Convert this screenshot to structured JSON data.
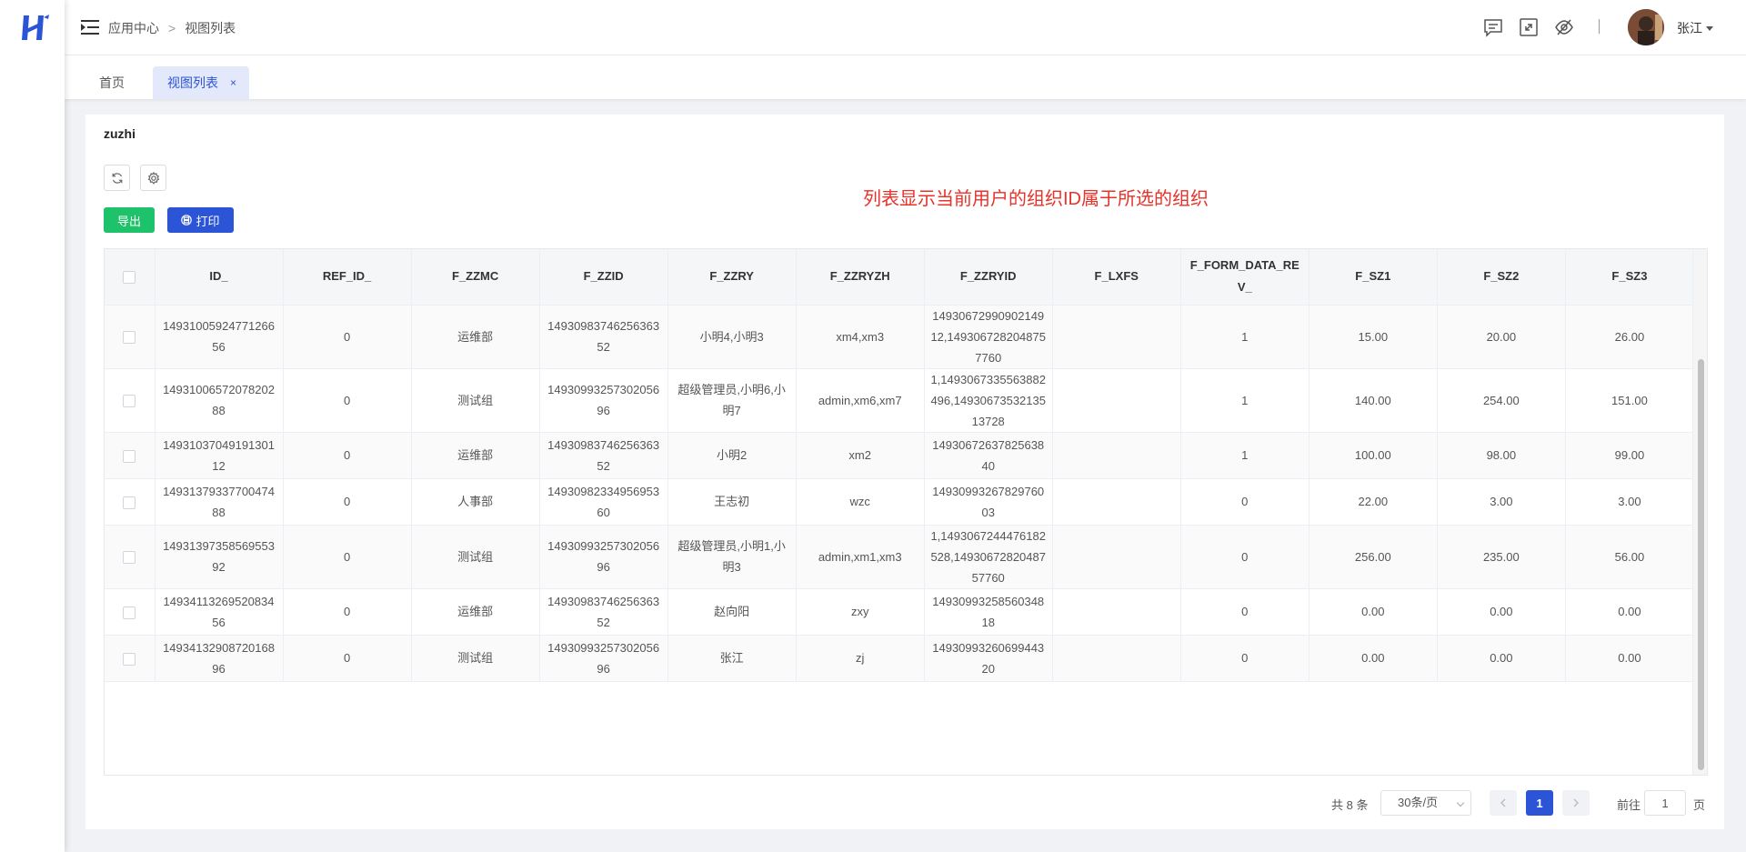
{
  "header": {
    "breadcrumb": [
      "应用中心",
      "视图列表"
    ],
    "breadcrumb_sep": ">",
    "user_name": "张江"
  },
  "tabs": [
    {
      "label": "首页",
      "active": false
    },
    {
      "label": "视图列表",
      "active": true,
      "close": "×"
    }
  ],
  "page": {
    "title": "zuzhi",
    "note": "列表显示当前用户的组织ID属于所选的组织",
    "export_label": "导出",
    "print_label": "打印"
  },
  "table": {
    "columns": [
      "ID_",
      "REF_ID_",
      "F_ZZMC",
      "F_ZZID",
      "F_ZZRY",
      "F_ZZRYZH",
      "F_ZZRYID",
      "F_LXFS",
      "F_FORM_DATA_REV_",
      "F_SZ1",
      "F_SZ2",
      "F_SZ3"
    ],
    "rows": [
      [
        "1493100592477126656",
        "0",
        "运维部",
        "1493098374625636352",
        "小明4,小明3",
        "xm4,xm3",
        "1493067299090214912,1493067282048757760",
        "",
        "1",
        "15.00",
        "20.00",
        "26.00"
      ],
      [
        "1493100657207820288",
        "0",
        "测试组",
        "1493099325730205696",
        "超级管理员,小明6,小明7",
        "admin,xm6,xm7",
        "1,1493067335563882496,1493067353213513728",
        "",
        "1",
        "140.00",
        "254.00",
        "151.00"
      ],
      [
        "1493103704919130112",
        "0",
        "运维部",
        "1493098374625636352",
        "小明2",
        "xm2",
        "1493067263782563840",
        "",
        "1",
        "100.00",
        "98.00",
        "99.00"
      ],
      [
        "1493137933770047488",
        "0",
        "人事部",
        "1493098233495695360",
        "王志初",
        "wzc",
        "1493099326782976003",
        "",
        "0",
        "22.00",
        "3.00",
        "3.00"
      ],
      [
        "1493139735856955392",
        "0",
        "测试组",
        "1493099325730205696",
        "超级管理员,小明1,小明3",
        "admin,xm1,xm3",
        "1,1493067244476182528,1493067282048757760",
        "",
        "0",
        "256.00",
        "235.00",
        "56.00"
      ],
      [
        "1493411326952083456",
        "0",
        "运维部",
        "1493098374625636352",
        "赵向阳",
        "zxy",
        "1493099325856034818",
        "",
        "0",
        "0.00",
        "0.00",
        "0.00"
      ],
      [
        "1493413290872016896",
        "0",
        "测试组",
        "1493099325730205696",
        "张江",
        "zj",
        "1493099326069944320",
        "",
        "0",
        "0.00",
        "0.00",
        "0.00"
      ]
    ]
  },
  "pagination": {
    "total": "共 8 条",
    "page_size": "30条/页",
    "current_page": "1",
    "goto_label": "前往",
    "goto_value": "1",
    "goto_suffix": "页"
  },
  "colors": {
    "primary": "#2b55d6",
    "export": "#1ec26a",
    "note": "#e8322a"
  }
}
